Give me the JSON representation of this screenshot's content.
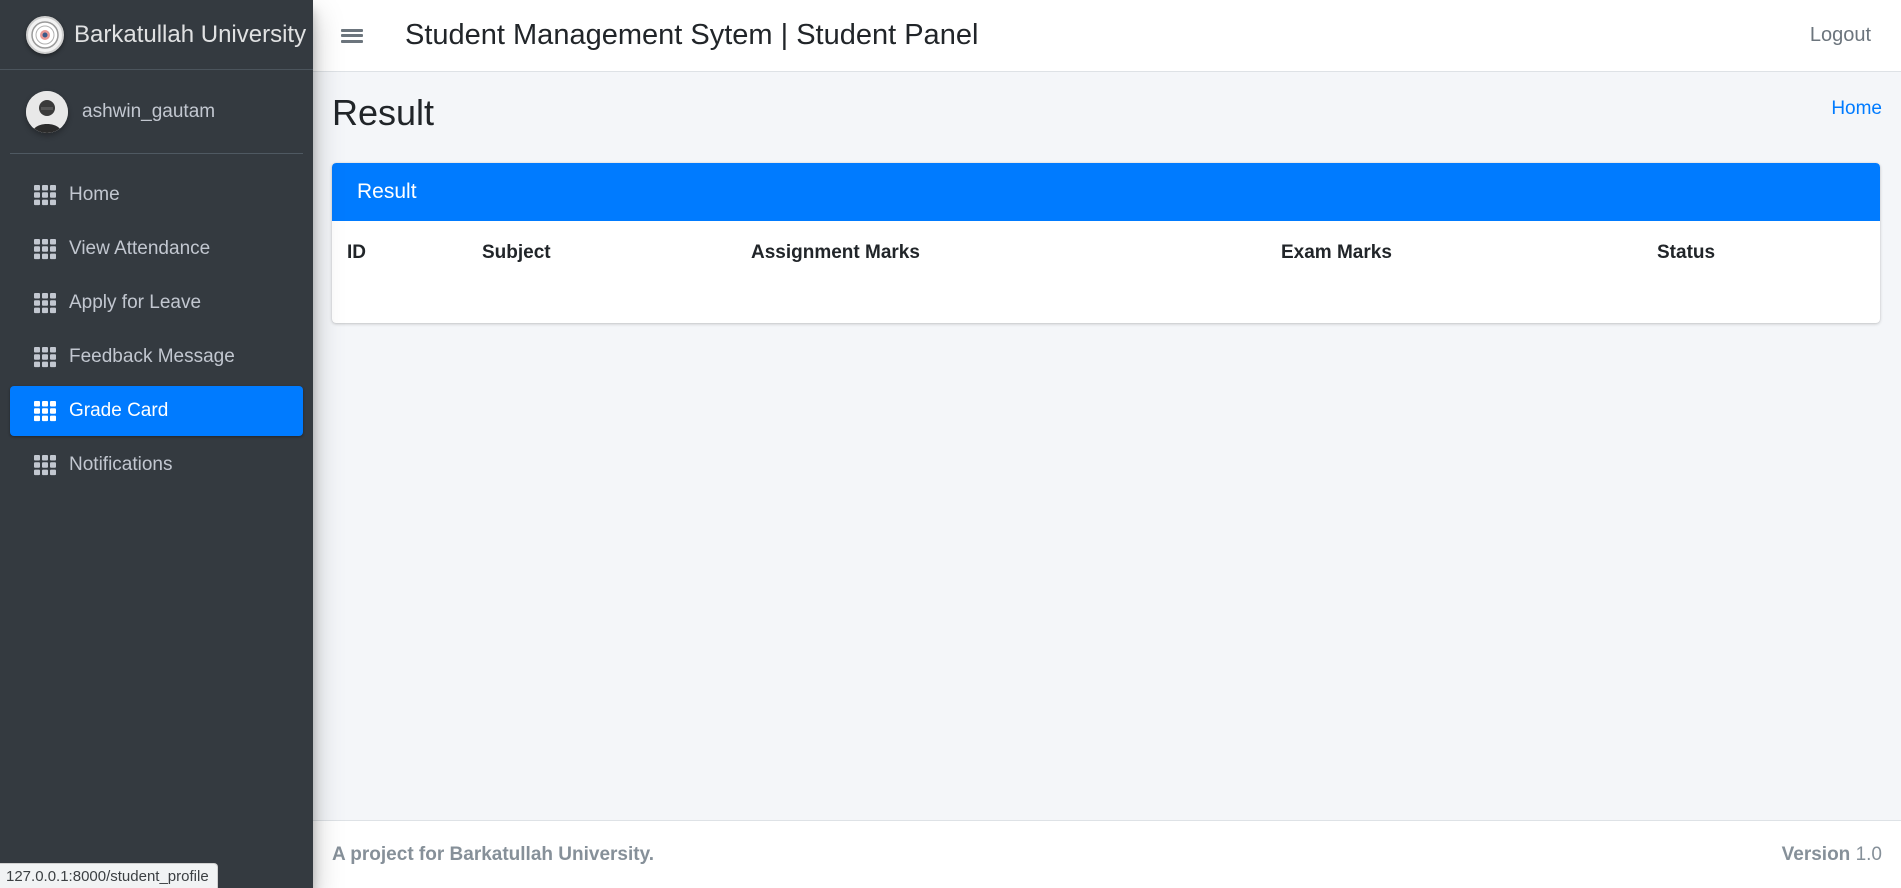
{
  "brand": {
    "name": "Barkatullah University"
  },
  "user": {
    "name": "ashwin_gautam"
  },
  "sidebar": {
    "items": [
      {
        "label": "Home",
        "icon": "th-grid-icon",
        "active": false
      },
      {
        "label": "View Attendance",
        "icon": "th-grid-icon",
        "active": false
      },
      {
        "label": "Apply for Leave",
        "icon": "th-grid-icon",
        "active": false
      },
      {
        "label": "Feedback Message",
        "icon": "th-grid-icon",
        "active": false
      },
      {
        "label": "Grade Card",
        "icon": "th-grid-icon",
        "active": true
      },
      {
        "label": "Notifications",
        "icon": "th-grid-icon",
        "active": false
      }
    ]
  },
  "header": {
    "title": "Student Management Sytem | Student Panel",
    "logout_label": "Logout"
  },
  "page": {
    "title": "Result",
    "breadcrumb_home": "Home"
  },
  "card": {
    "title": "Result",
    "columns": [
      "ID",
      "Subject",
      "Assignment Marks",
      "Exam Marks",
      "Status"
    ],
    "rows": []
  },
  "footer": {
    "left_text": "A project for Barkatullah University.",
    "version_label": "Version",
    "version_value": "1.0"
  },
  "status_bar": {
    "url": "127.0.0.1:8000/student_profile"
  },
  "colors": {
    "sidebar_bg": "#343a40",
    "primary": "#007bff",
    "content_bg": "#f4f6f9",
    "muted_text": "#869099"
  }
}
